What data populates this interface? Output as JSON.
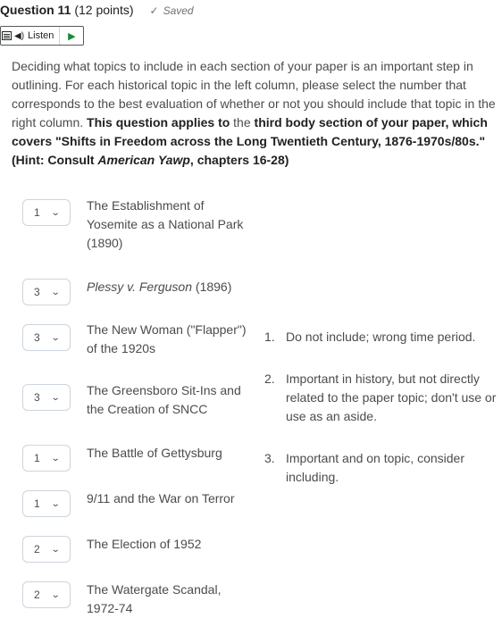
{
  "question": {
    "title": "Question 11",
    "points": "(12 points)",
    "status": "Saved",
    "status_icon": "check-icon"
  },
  "listen": {
    "label": "Listen",
    "speaker_icon": "speaker-icon",
    "play_icon": "play-icon"
  },
  "prompt": {
    "p1": "Deciding what topics to include in each section of your paper is an important step in outlining. For each historical topic in the left column, please select the number that corresponds to the best evaluation of whether or not you should include that topic in the right column.",
    "b1": "This question applies to",
    "p2": "the",
    "b2": "third body section of your paper, which covers \"Shifts in Freedom across the Long Twentieth Century, 1876-1970s/80s.\" (Hint: Consult",
    "i1": "American Yawp",
    "b3": ", chapters 16-28)"
  },
  "items": [
    {
      "value": "1",
      "topic": "The Establishment of Yosemite as a National Park (1890)"
    },
    {
      "value": "3",
      "topic_italic": "Plessy v. Ferguson",
      "topic": " (1896)"
    },
    {
      "value": "3",
      "topic": "The New Woman (\"Flapper\") of the 1920s"
    },
    {
      "value": "3",
      "topic": "The Greensboro Sit-Ins and the Creation of SNCC"
    },
    {
      "value": "1",
      "topic": "The Battle of Gettysburg"
    },
    {
      "value": "1",
      "topic": "9/11 and the War on Terror"
    },
    {
      "value": "2",
      "topic": "The Election of 1952"
    },
    {
      "value": "2",
      "topic": "The Watergate Scandal, 1972-74"
    }
  ],
  "options": [
    {
      "num": "1.",
      "text": "Do not include; wrong time period."
    },
    {
      "num": "2.",
      "text": "Important in history, but not directly related to the paper topic; don't use or use as an aside."
    },
    {
      "num": "3.",
      "text": "Important and on topic, consider including."
    }
  ]
}
